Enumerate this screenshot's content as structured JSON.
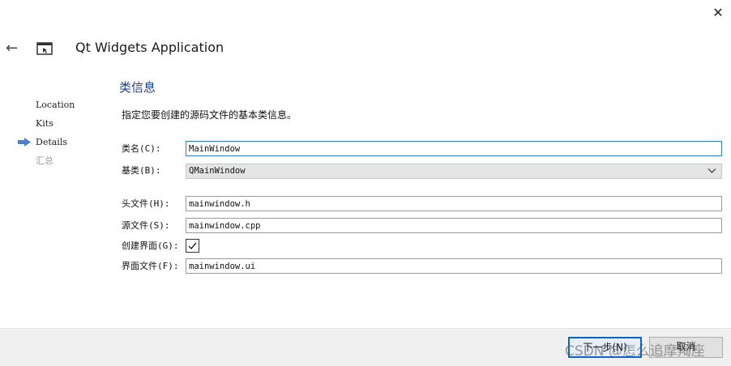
{
  "window": {
    "title": "Qt Widgets Application",
    "close_glyph": "✕",
    "back_glyph": "←"
  },
  "nav": {
    "items": [
      {
        "label": "Location",
        "state": "done"
      },
      {
        "label": "Kits",
        "state": "done"
      },
      {
        "label": "Details",
        "state": "current"
      },
      {
        "label": "汇总",
        "state": "disabled"
      }
    ]
  },
  "page": {
    "heading": "类信息",
    "description": "指定您要创建的源码文件的基本类信息。"
  },
  "form": {
    "class_name": {
      "label": "类名(C):",
      "value": "MainWindow"
    },
    "base_class": {
      "label": "基类(B):",
      "value": "QMainWindow"
    },
    "header_file": {
      "label": "头文件(H):",
      "value": "mainwindow.h"
    },
    "source_file": {
      "label": "源文件(S):",
      "value": "mainwindow.cpp"
    },
    "create_form": {
      "label": "创建界面(G):",
      "checked": true
    },
    "form_file": {
      "label": "界面文件(F):",
      "value": "mainwindow.ui"
    }
  },
  "footer": {
    "next_label": "下一步(N)",
    "cancel_label": "取消",
    "watermark": "CSDN @怎么追摩羯座"
  },
  "colors": {
    "accent": "#1e3e8a",
    "focus_border": "#2d7bd4",
    "nav_arrow": "#4a7fd0"
  }
}
